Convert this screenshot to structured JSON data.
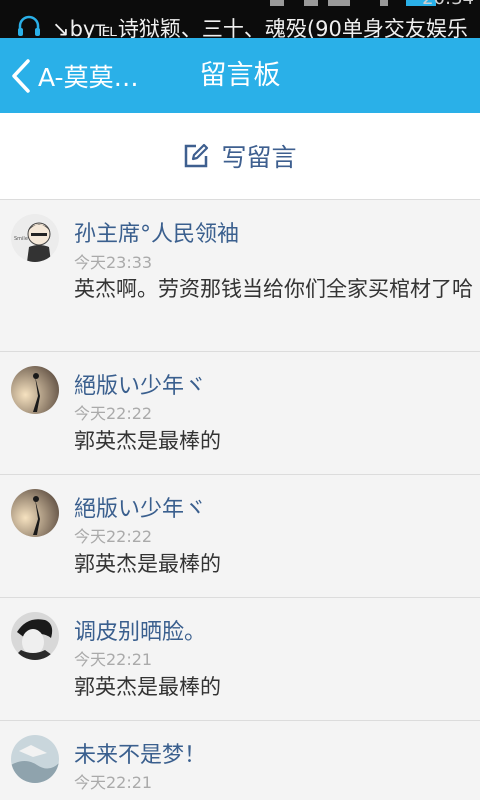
{
  "status_bar": {
    "ticker": "↘by℡诗狱颖、三十、魂殁(90单身交友娱乐",
    "clock": "20:34"
  },
  "header": {
    "back_label": "A-莫莫…",
    "title": "留言板"
  },
  "write_button": {
    "label": "写留言",
    "icon": "edit-icon"
  },
  "messages": [
    {
      "name": "孙主席°人民领袖",
      "time": "今天23:33",
      "text": "英杰啊。劳资那钱当给你们全家买棺材了哈"
    },
    {
      "name": "絕版い少年ヾ",
      "time": "今天22:22",
      "text": "郭英杰是最棒的"
    },
    {
      "name": "絕版い少年ヾ",
      "time": "今天22:22",
      "text": "郭英杰是最棒的"
    },
    {
      "name": "调皮别晒脸。",
      "time": "今天22:21",
      "text": "郭英杰是最棒的"
    },
    {
      "name": "未来不是梦！",
      "time": "今天22:21",
      "text": ""
    }
  ],
  "colors": {
    "header_bg": "#2ab0e8",
    "name_color": "#3a5f8e",
    "time_color": "#aaaaaa"
  }
}
